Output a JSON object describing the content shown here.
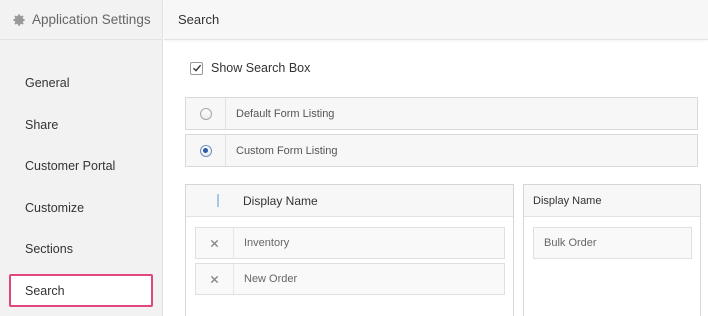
{
  "sidebar": {
    "title": "Application Settings",
    "header_icon": "gear-icon",
    "items": [
      {
        "label": "General",
        "active": false
      },
      {
        "label": "Share",
        "active": false
      },
      {
        "label": "Customer Portal",
        "active": false
      },
      {
        "label": "Customize",
        "active": false
      },
      {
        "label": "Sections",
        "active": false
      },
      {
        "label": "Search",
        "active": true
      }
    ],
    "active_border_color": "#e0467f"
  },
  "main": {
    "title": "Search",
    "show_search_box": {
      "label": "Show Search Box",
      "checked": true
    },
    "listing_options": [
      {
        "label": "Default Form Listing",
        "selected": false
      },
      {
        "label": "Custom Form Listing",
        "selected": true
      }
    ],
    "selected_panel": {
      "header": "Display Name",
      "fields": [
        "Inventory",
        "New Order"
      ]
    },
    "available_panel": {
      "header": "Display Name",
      "fields": [
        "Bulk Order"
      ]
    }
  }
}
